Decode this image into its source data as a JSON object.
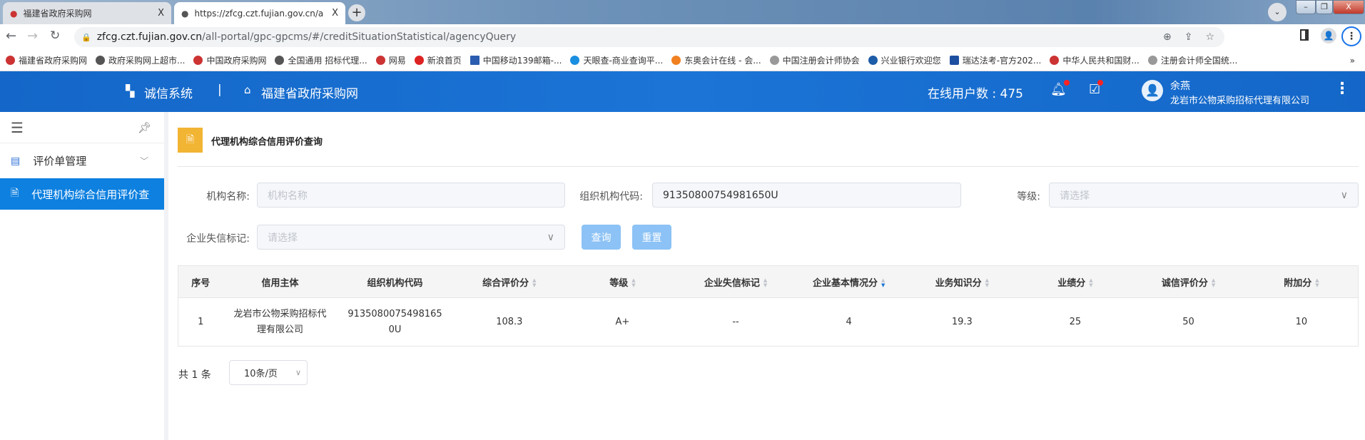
{
  "browser": {
    "tabs": [
      {
        "title": "福建省政府采购网",
        "close": "X"
      },
      {
        "title": "https://zfcg.czt.fujian.gov.cn/a",
        "close": "X"
      }
    ],
    "new_tab": "+",
    "window_controls": [
      "–",
      "❐",
      "X"
    ],
    "url_host": "zfcg.czt.fujian.gov.cn",
    "url_path": "/all-portal/gpc-gpcms/#/creditSituationStatistical/agencyQuery",
    "bookmarks": [
      "福建省政府采购网",
      "政府采购网上超市...",
      "中国政府采购网",
      "全国通用 招标代理...",
      "网易",
      "新浪首页",
      "中国移动139邮箱-...",
      "天眼查-商业查询平...",
      "东奥会计在线 - 会...",
      "中国注册会计师协会",
      "兴业银行欢迎您",
      "瑞达法考-官方202...",
      "中华人民共和国财...",
      "注册会计师全国统..."
    ],
    "bookmarks_more": "»"
  },
  "header": {
    "system": "诚信系统",
    "site": "福建省政府采购网",
    "separator": "|",
    "online_label": "在线用户数 : 475",
    "user_name": "余燕",
    "user_org": "龙岩市公物采购招标代理有限公司"
  },
  "sidebar": {
    "items": [
      {
        "label": "评价单管理",
        "icon": "form-icon"
      },
      {
        "label": "代理机构综合信用评价查",
        "icon": "search-doc-icon",
        "active": true
      }
    ]
  },
  "page": {
    "title": "代理机构综合信用评价查询"
  },
  "filters": {
    "name_label": "机构名称:",
    "name_placeholder": "机构名称",
    "code_label": "组织机构代码:",
    "code_value": "91350800754981650U",
    "grade_label": "等级:",
    "grade_placeholder": "请选择",
    "dishonest_label": "企业失信标记:",
    "dishonest_placeholder": "请选择",
    "query": "查询",
    "reset": "重置"
  },
  "table": {
    "columns": [
      "序号",
      "信用主体",
      "组织机构代码",
      "综合评价分",
      "等级",
      "企业失信标记",
      "企业基本情况分",
      "业务知识分",
      "业绩分",
      "诚信评价分",
      "附加分"
    ],
    "sortable": [
      false,
      false,
      false,
      true,
      true,
      true,
      true,
      true,
      true,
      true,
      true
    ],
    "active_sort": "企业基本情况分 desc",
    "rows": [
      [
        "1",
        "龙岩市公物采购招标代理有限公司",
        "91350800754981650U",
        "108.3",
        "A+",
        "--",
        "4",
        "19.3",
        "25",
        "50",
        "10"
      ]
    ]
  },
  "pagination": {
    "total": "共 1 条",
    "page_size": "10条/页"
  },
  "colors": {
    "header": "#1b74d6",
    "active_menu": "#0e80e0",
    "title_icon": "#f2b433",
    "button": "#8cc2f5"
  }
}
